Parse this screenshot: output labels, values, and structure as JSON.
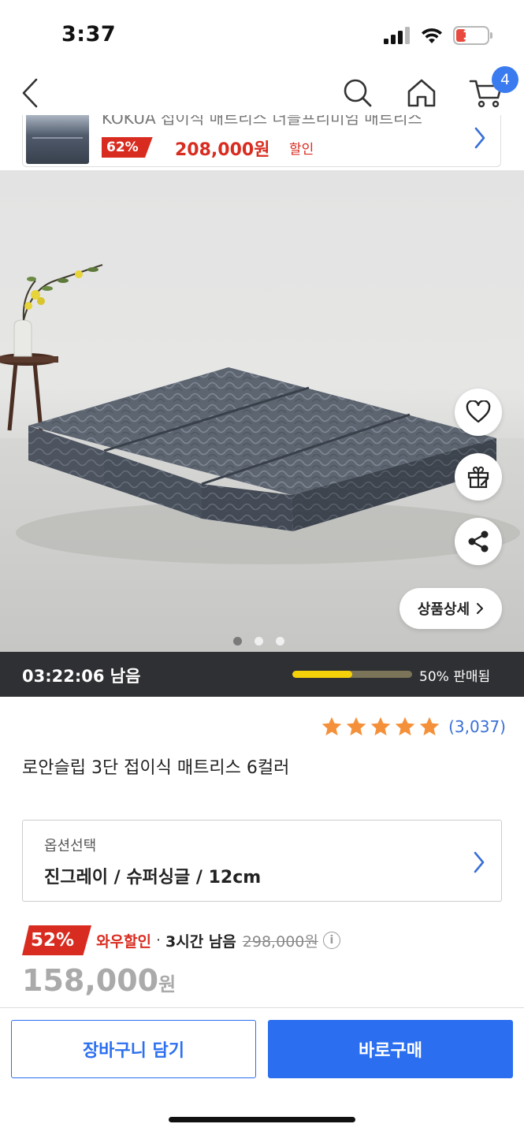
{
  "status_bar": {
    "time": "3:37",
    "battery": "17"
  },
  "nav": {
    "cart_count": "4",
    "icons": [
      "back-icon",
      "search-icon",
      "home-icon",
      "cart-icon"
    ]
  },
  "promo": {
    "cut_text": "KOKUA 접이식 매트리스 더블프리미엄 매트리스",
    "discount": "62%",
    "price": "208,000원",
    "sale_label": "할인"
  },
  "hero": {
    "detail_button": "상품상세",
    "slide_count": 3,
    "active_slide": 1,
    "icons": [
      "heart-icon",
      "gift-icon",
      "share-icon"
    ]
  },
  "timer": {
    "remaining": "03:22:06 남음",
    "sold_fraction": 0.5,
    "sold_label": "50% 판매됨"
  },
  "product": {
    "rating_stars": 5,
    "review_count": "(3,037)",
    "title": "로안슬립 3단 접이식 매트리스 6컬러"
  },
  "option": {
    "label": "옵션선택",
    "value": "진그레이 / 슈퍼싱글 / 12cm"
  },
  "price": {
    "discount": "52%",
    "wow": "와우할인",
    "separator": "·",
    "remaining": "3시간 남음",
    "original": "298,000원",
    "info": "i",
    "sale": "158,000",
    "currency": "원"
  },
  "actions": {
    "cart": "장바구니 담기",
    "buy": "바로구매"
  },
  "colors": {
    "accent": "#2b6ff0",
    "discount_red": "#d92c20",
    "timer_bg": "#2f3033",
    "progress_yellow": "#f5d10a",
    "star": "#f5903a"
  }
}
